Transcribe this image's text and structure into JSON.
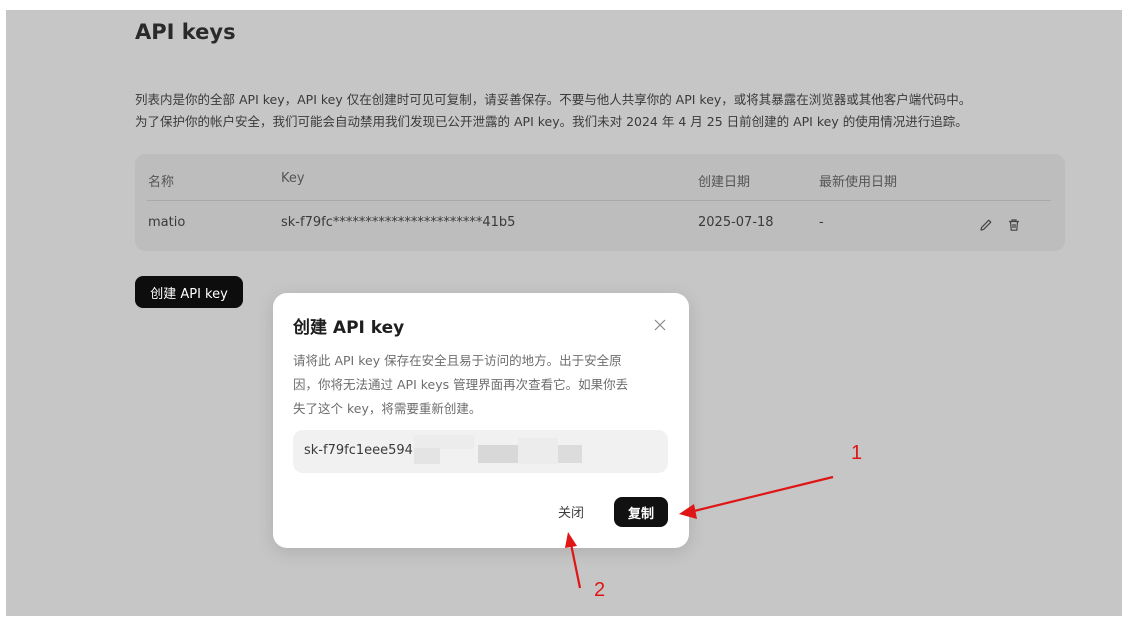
{
  "page": {
    "title": "API keys",
    "description_line1": "列表内是你的全部 API key，API key 仅在创建时可见可复制，请妥善保存。不要与他人共享你的 API key，或将其暴露在浏览器或其他客户端代码中。",
    "description_line2": "为了保护你的帐户安全，我们可能会自动禁用我们发现已公开泄露的 API key。我们未对 2024 年 4 月 25 日前创建的 API key 的使用情况进行追踪。"
  },
  "table": {
    "headers": [
      "名称",
      "Key",
      "创建日期",
      "最新使用日期"
    ],
    "rows": [
      {
        "name": "matio",
        "key": "sk-f79fc***********************41b5",
        "created": "2025-07-18",
        "last_used": "-"
      }
    ]
  },
  "create_button": {
    "label": "创建 API key"
  },
  "modal": {
    "title": "创建 API key",
    "text_line1": "请将此 API key 保存在安全且易于访问的地方。出于安全原",
    "text_line2": "因，你将无法通过 API keys 管理界面再次查看它。如果你丢",
    "text_line3": "失了这个 key，将需要重新创建。",
    "key_value": "sk-f79fc1eee594",
    "close_label": "关闭",
    "copy_label": "复制"
  },
  "annotations": {
    "one": "1",
    "two": "2",
    "color": "#e01515"
  },
  "icons": [
    "edit-icon",
    "trash-icon",
    "close-icon"
  ],
  "colors": {
    "overlay": "#c6c6c6",
    "primary_button": "#0d0d0d",
    "modal_bg": "#ffffff"
  }
}
